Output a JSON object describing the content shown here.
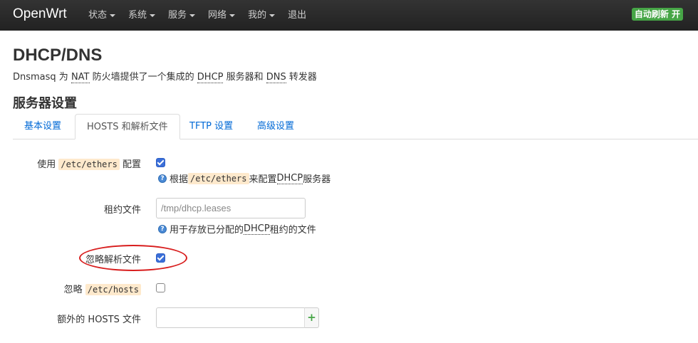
{
  "navbar": {
    "brand": "OpenWrt",
    "menu": [
      {
        "label": "状态",
        "has_caret": true
      },
      {
        "label": "系统",
        "has_caret": true
      },
      {
        "label": "服务",
        "has_caret": true
      },
      {
        "label": "网络",
        "has_caret": true
      },
      {
        "label": "我的",
        "has_caret": true
      },
      {
        "label": "退出",
        "has_caret": false
      }
    ],
    "refresh_badge": "自动刷新 开"
  },
  "page": {
    "title": "DHCP/DNS",
    "description": {
      "p1": "Dnsmasq 为 ",
      "nat": "NAT",
      "p2": " 防火墙提供了一个集成的 ",
      "dhcp": "DHCP",
      "p3": " 服务器和 ",
      "dns": "DNS",
      "p4": " 转发器"
    }
  },
  "section": {
    "title": "服务器设置",
    "tabs": [
      {
        "label": "基本设置",
        "active": false
      },
      {
        "label": "HOSTS 和解析文件",
        "active": true
      },
      {
        "label": "TFTP 设置",
        "active": false
      },
      {
        "label": "高级设置",
        "active": false
      }
    ]
  },
  "fields": {
    "use_ethers": {
      "label_pre": "使用 ",
      "label_code": "/etc/ethers",
      "label_post": " 配置",
      "checked": true,
      "help_pre": "根据 ",
      "help_code": "/etc/ethers",
      "help_mid": " 来配置 ",
      "help_abbr": "DHCP",
      "help_post": " 服务器"
    },
    "leasefile": {
      "label": "租约文件",
      "value": "/tmp/dhcp.leases",
      "help_pre": "用于存放已分配的 ",
      "help_abbr": "DHCP",
      "help_post": " 租约的文件"
    },
    "noresolv": {
      "label": "忽略解析文件",
      "checked": true
    },
    "nohosts": {
      "label_pre": "忽略 ",
      "label_code": "/etc/hosts",
      "checked": false
    },
    "addnhosts": {
      "label": "额外的 HOSTS 文件",
      "value": "",
      "add_symbol": "+"
    }
  },
  "colors": {
    "navbar_bg": "#222222",
    "badge_green": "#46a546",
    "link_blue": "#0069d6",
    "checkbox_blue": "#3b6fd8",
    "highlight_red": "#d81e1e",
    "code_bg": "#fee9cc"
  }
}
